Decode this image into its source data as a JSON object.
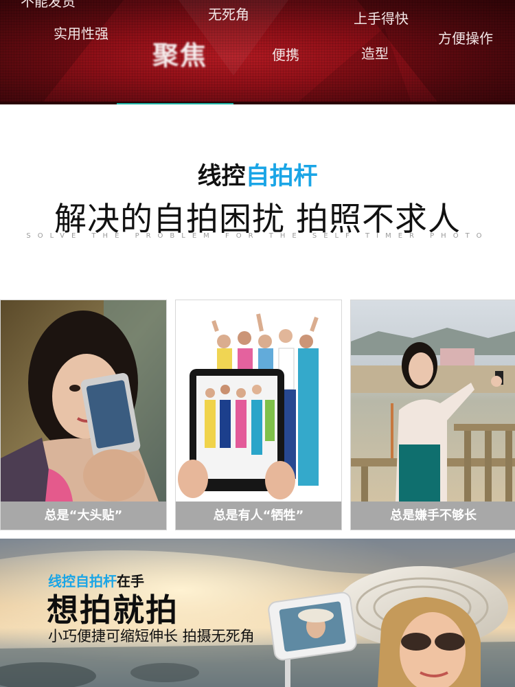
{
  "banner": {
    "words": [
      "不能发货",
      "无死角",
      "上手得快",
      "实用性强",
      "聚焦",
      "便携",
      "造型",
      "方便操作"
    ]
  },
  "intro": {
    "title_black": "线控",
    "title_blue": "自拍杆",
    "headline": "解决的自拍困扰 拍照不求人",
    "subtitle_en": "SOLVE THE PROBLEM FOR THE SELF TIMER PHOTO"
  },
  "cards": [
    {
      "caption": "总是“大头贴”"
    },
    {
      "caption": "总是有人“牺牲”"
    },
    {
      "caption": "总是嫌手不够长"
    }
  ],
  "promo": {
    "title_blue": "线控自拍杆",
    "title_black": "在手",
    "headline": "想拍就拍",
    "tagline": "小巧便捷可缩短伸长 拍摄无死角"
  },
  "colors": {
    "accent_blue": "#1aa5e6",
    "banner_red": "#8e0f17",
    "caption_gray": "#a8a8a8"
  }
}
